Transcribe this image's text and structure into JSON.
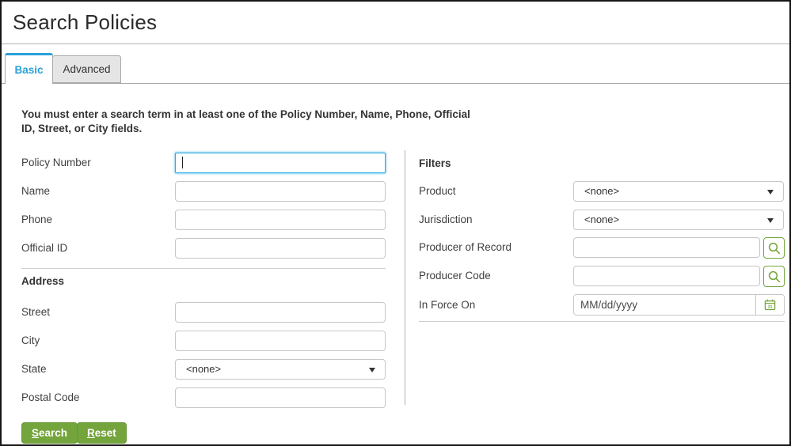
{
  "title": "Search Policies",
  "tabs": {
    "basic": "Basic",
    "advanced": "Advanced"
  },
  "message": "You must enter a search term in at least one of the Policy Number, Name, Phone, Official ID, Street, or City fields.",
  "search_fields": {
    "policy_number": {
      "label": "Policy Number",
      "value": ""
    },
    "name": {
      "label": "Name",
      "value": ""
    },
    "phone": {
      "label": "Phone",
      "value": ""
    },
    "official_id": {
      "label": "Official ID",
      "value": ""
    }
  },
  "address": {
    "header": "Address",
    "street": {
      "label": "Street",
      "value": ""
    },
    "city": {
      "label": "City",
      "value": ""
    },
    "state": {
      "label": "State",
      "selected": "<none>"
    },
    "postal_code": {
      "label": "Postal Code",
      "value": ""
    }
  },
  "filters": {
    "header": "Filters",
    "product": {
      "label": "Product",
      "selected": "<none>"
    },
    "jurisdiction": {
      "label": "Jurisdiction",
      "selected": "<none>"
    },
    "producer_of_record": {
      "label": "Producer of Record",
      "value": ""
    },
    "producer_code": {
      "label": "Producer Code",
      "value": ""
    },
    "in_force_on": {
      "label": "In Force On",
      "value": "",
      "placeholder": "MM/dd/yyyy"
    }
  },
  "buttons": {
    "search": "Search",
    "reset": "Reset"
  },
  "icons": {
    "producer_of_record_button": "search-icon",
    "producer_code_button": "search-icon",
    "in_force_on_button": "calendar-icon",
    "dropdowns": "caret-down-icon"
  },
  "colors": {
    "active_tab_blue": "#2aa0da",
    "focused_input_cyan": "#29abe2",
    "button_green": "#74a43c",
    "icon_green": "#74a43c"
  }
}
